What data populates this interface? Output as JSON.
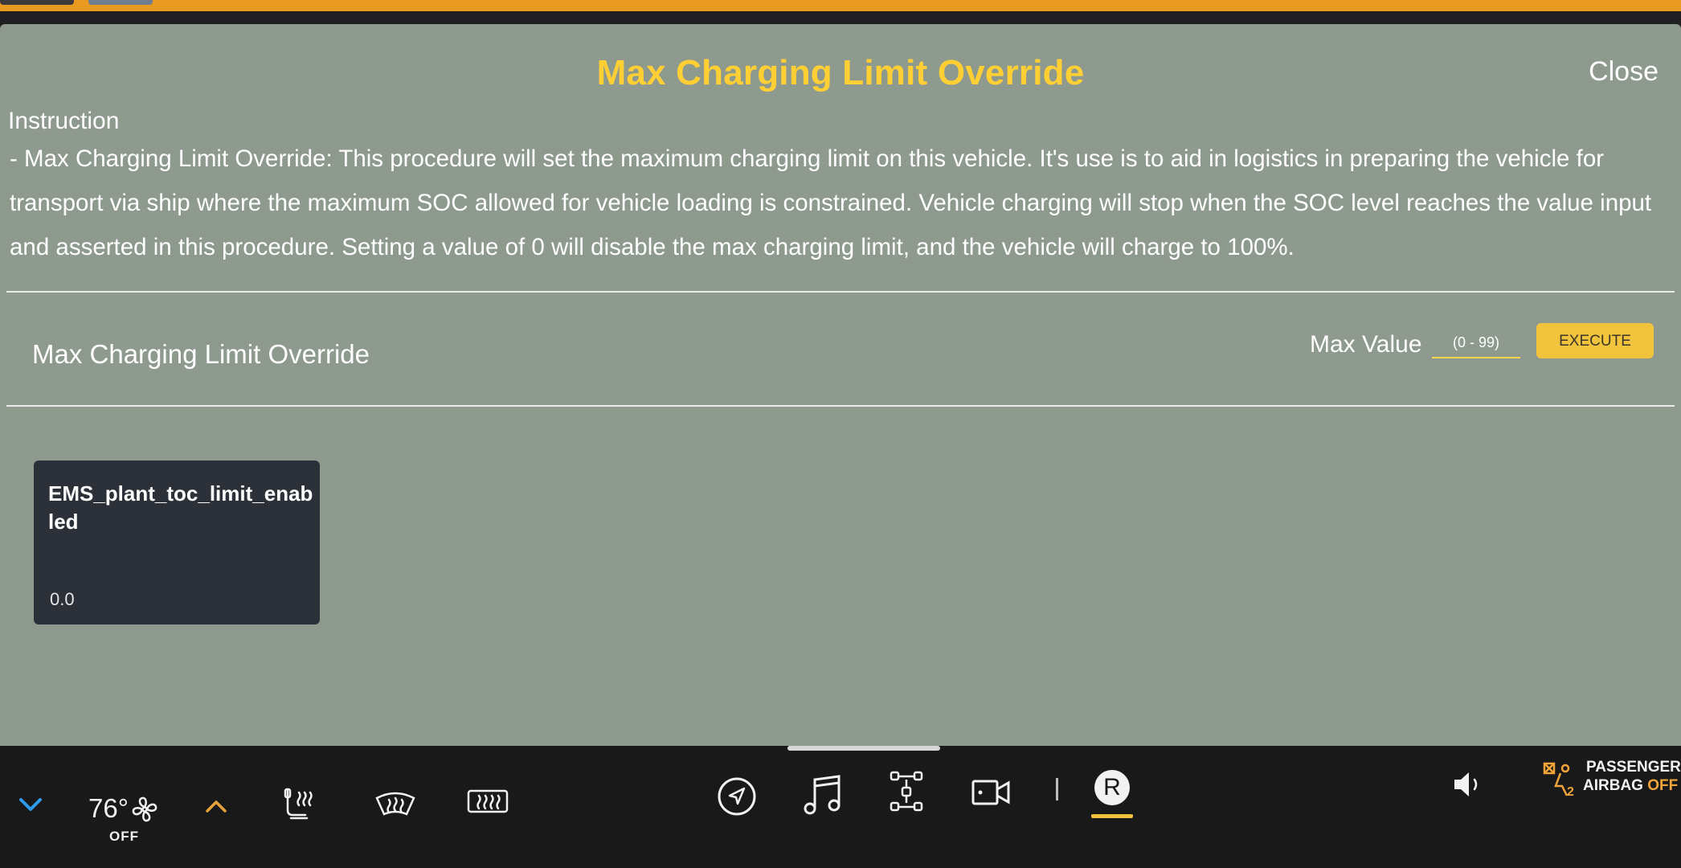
{
  "modal": {
    "title": "Max Charging Limit Override",
    "close_label": "Close",
    "instruction_heading": "Instruction",
    "instruction_text": " - Max Charging Limit Override:  This procedure will set the maximum charging limit on this vehicle.  It's use is to aid in logistics in preparing the vehicle for transport via ship where the maximum SOC allowed for vehicle loading is constrained.  Vehicle charging will stop when the SOC level reaches the value input and asserted in this procedure.  Setting a value of 0 will disable the max charging limit, and the vehicle will charge to 100%."
  },
  "procedure": {
    "section_title": "Max Charging Limit Override",
    "max_value_label": "Max Value",
    "input_placeholder": "(0 - 99)",
    "input_value": "",
    "execute_label": "EXECUTE"
  },
  "signal": {
    "name": "EMS_plant_toc_limit_enabled",
    "value": "0.0"
  },
  "bottom_bar": {
    "temperature": "76°",
    "climate_status": "OFF",
    "drive_letter": "R",
    "airbag_line1": "PASSENGER",
    "airbag_line2_prefix": "AIRBAG ",
    "airbag_status": "OFF",
    "icons": [
      "chevron-down-icon",
      "fan-icon",
      "chevron-up-icon",
      "seat-heat-icon",
      "front-defrost-icon",
      "rear-defrost-icon",
      "navigation-icon",
      "music-icon",
      "apps-icon",
      "camera-icon",
      "volume-icon",
      "airbag-icon"
    ]
  },
  "colors": {
    "title": "#ffcf33",
    "modal_background": "#8e9a8e",
    "execute_button": "#f2c33c",
    "card_background": "#2c3038",
    "accent_underline": "#f0c23b",
    "airbag_off": "#f0a43a"
  }
}
